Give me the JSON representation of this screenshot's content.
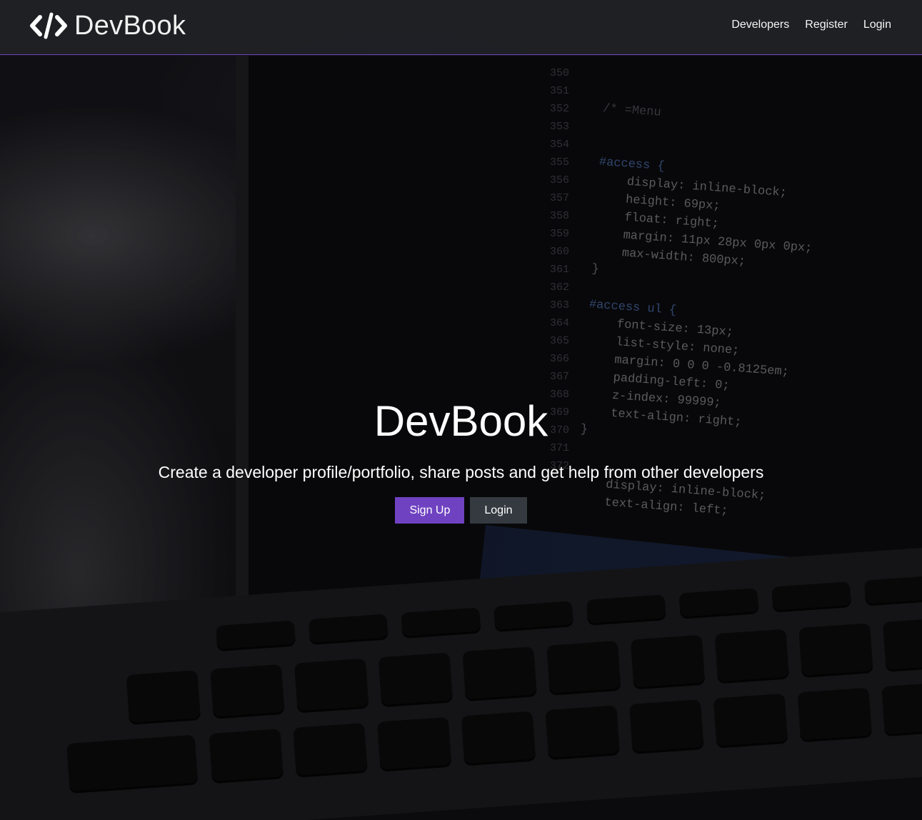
{
  "navbar": {
    "brand_icon": "code-icon",
    "brand": "DevBook",
    "links": [
      "Developers",
      "Register",
      "Login"
    ]
  },
  "hero": {
    "title": "DevBook",
    "subtitle": "Create a developer profile/portfolio, share posts and get help from other developers",
    "buttons": [
      "Sign Up",
      "Login"
    ]
  },
  "colors": {
    "accent": "#6f42c1",
    "dark_button": "#343a40",
    "navbar_bg": "#202125"
  },
  "background": {
    "gutter_numbers": [
      "350",
      "351",
      "352",
      "353",
      "354",
      "355",
      "356",
      "357",
      "358",
      "359",
      "360",
      "361",
      "362",
      "363",
      "364",
      "365",
      "366",
      "367",
      "368",
      "369",
      "370",
      "371",
      "372"
    ],
    "code_lines": [
      "/* =Menu",
      "",
      "",
      "#access {",
      "    display: inline-block;",
      "    height: 69px;",
      "    float: right;",
      "    margin: 11px 28px 0px 0px;",
      "    max-width: 800px;",
      "}",
      "",
      "#access ul {",
      "    font-size: 13px;",
      "    list-style: none;",
      "    margin: 0 0 0 -0.8125em;",
      "    padding-left: 0;",
      "    z-index: 99999;",
      "    text-align: right;",
      "}",
      "",
      "",
      "    display: inline-block;",
      "    text-align: left;"
    ]
  }
}
